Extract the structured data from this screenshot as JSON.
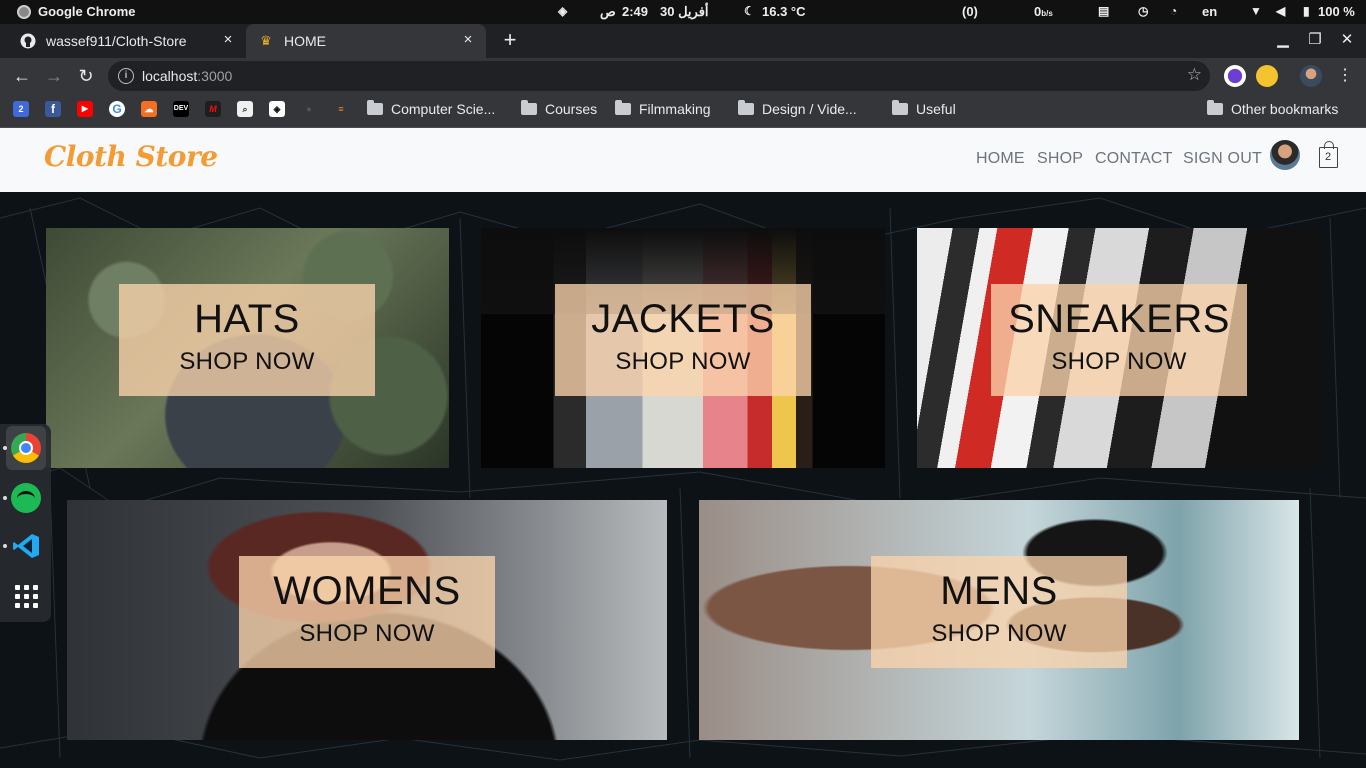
{
  "os": {
    "app_name": "Google Chrome",
    "clock": "2:49",
    "date": "أفريل 30",
    "ampm": "ص",
    "temperature": "16.3 °C",
    "notifications": "(0)",
    "net_speed": "0",
    "net_unit": "b/s",
    "language": "en",
    "battery": "100 %"
  },
  "tabs": [
    {
      "title": "wassef911/Cloth-Store"
    },
    {
      "title": "HOME"
    }
  ],
  "address": {
    "host": "localhost",
    "port": ":3000"
  },
  "bookmarks": {
    "folders": [
      "Computer Scie...",
      "Courses",
      "Filmmaking",
      "Design / Vide...",
      "Useful"
    ],
    "other": "Other bookmarks",
    "calendar_day": "2",
    "dev_label": "DEV"
  },
  "site": {
    "logo": "Cloth Store",
    "nav": [
      "HOME",
      "SHOP",
      "CONTACT",
      "SIGN OUT"
    ],
    "cart_count": "2"
  },
  "categories": [
    {
      "title": "HATS",
      "cta": "SHOP NOW"
    },
    {
      "title": "JACKETS",
      "cta": "SHOP NOW"
    },
    {
      "title": "SNEAKERS",
      "cta": "SHOP NOW"
    },
    {
      "title": "WOMENS",
      "cta": "SHOP NOW"
    },
    {
      "title": "MENS",
      "cta": "SHOP NOW"
    }
  ]
}
